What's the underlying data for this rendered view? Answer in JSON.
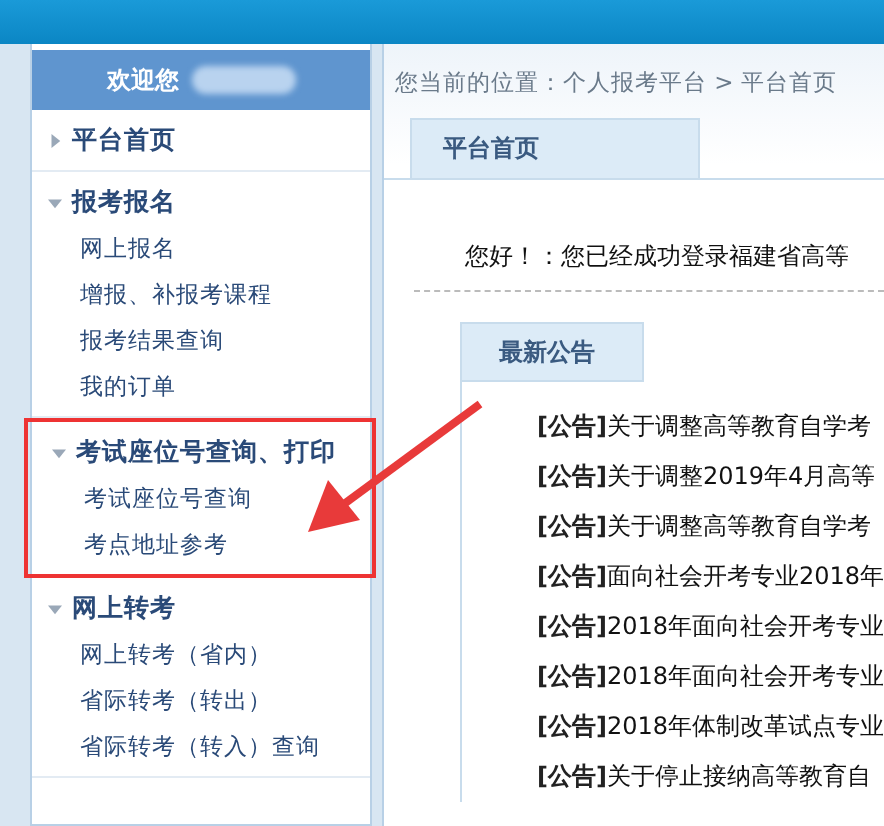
{
  "sidebar": {
    "welcome": "欢迎您",
    "sections": [
      {
        "title": "平台首页",
        "expanded": false,
        "highlighted": false
      },
      {
        "title": "报考报名",
        "expanded": true,
        "highlighted": false,
        "items": [
          "网上报名",
          "增报、补报考课程",
          "报考结果查询",
          "我的订单"
        ]
      },
      {
        "title": "考试座位号查询、打印",
        "expanded": true,
        "highlighted": true,
        "items": [
          "考试座位号查询",
          "考点地址参考"
        ]
      },
      {
        "title": "网上转考",
        "expanded": true,
        "highlighted": false,
        "items": [
          "网上转考（省内）",
          "省际转考（转出）",
          "省际转考（转入）查询"
        ]
      }
    ]
  },
  "breadcrumb": "您当前的位置：个人报考平台 > 平台首页",
  "tab": "平台首页",
  "greeting": "您好！：您已经成功登录福建省高等",
  "notices": {
    "title": "最新公告",
    "items": [
      {
        "tag": "[公告]",
        "text": "关于调整高等教育自学考"
      },
      {
        "tag": "[公告]",
        "text": "关于调整2019年4月高等"
      },
      {
        "tag": "[公告]",
        "text": "关于调整高等教育自学考"
      },
      {
        "tag": "[公告]",
        "text": "面向社会开考专业2018年"
      },
      {
        "tag": "[公告]",
        "text": "2018年面向社会开考专业"
      },
      {
        "tag": "[公告]",
        "text": "2018年面向社会开考专业"
      },
      {
        "tag": "[公告]",
        "text": "2018年体制改革试点专业"
      },
      {
        "tag": "[公告]",
        "text": "关于停止接纳高等教育自"
      }
    ]
  }
}
